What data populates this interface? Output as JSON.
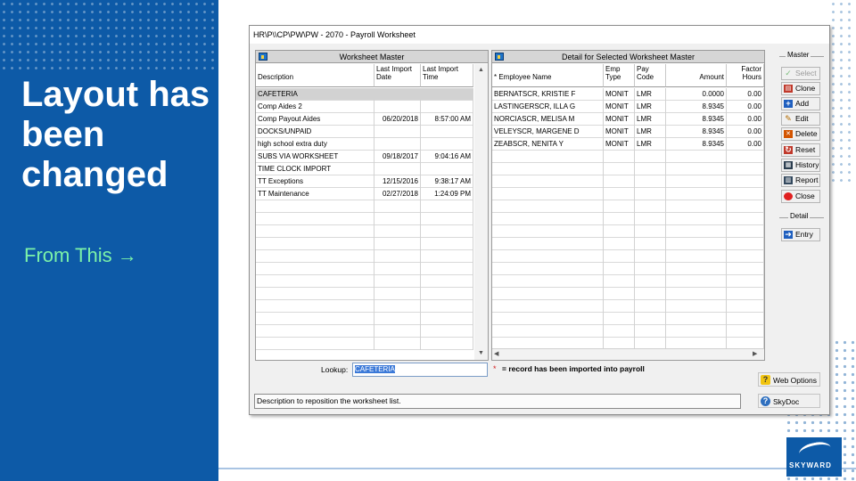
{
  "slide": {
    "title": "Layout has been changed",
    "from_label": "From This →",
    "logo_text": "SKYWARD"
  },
  "window": {
    "title": "HR\\P\\\\CP\\PW\\PW - 2070 - Payroll Worksheet"
  },
  "master": {
    "header": "Worksheet Master",
    "columns": [
      "Description",
      "Last Import\nDate",
      "Last Import\nTime"
    ],
    "rows": [
      {
        "description": "CAFETERIA",
        "date": "",
        "time": "",
        "selected": true
      },
      {
        "description": "Comp Aides 2",
        "date": "",
        "time": ""
      },
      {
        "description": "Comp Payout Aides",
        "date": "06/20/2018",
        "time": "8:57:00 AM"
      },
      {
        "description": "DOCKS/UNPAID",
        "date": "",
        "time": ""
      },
      {
        "description": "high school extra duty",
        "date": "",
        "time": ""
      },
      {
        "description": "SUBS VIA WORKSHEET",
        "date": "09/18/2017",
        "time": "9:04:16 AM"
      },
      {
        "description": "TIME CLOCK IMPORT",
        "date": "",
        "time": ""
      },
      {
        "description": "TT Exceptions",
        "date": "12/15/2016",
        "time": "9:38:17 AM"
      },
      {
        "description": "TT Maintenance",
        "date": "02/27/2018",
        "time": "1:24:09 PM"
      }
    ]
  },
  "detail": {
    "header": "Detail for Selected Worksheet Master",
    "columns": [
      "* Employee Name",
      "Emp\nType",
      "Pay\nCode",
      "Amount",
      "Factor\nHours"
    ],
    "rows": [
      {
        "name": "BERNATSCR, KRISTIE F",
        "emp_type": "MONIT",
        "pay_code": "LMR",
        "amount": "0.0000",
        "factor": "0.00"
      },
      {
        "name": "LASTINGERSCR, ILLA G",
        "emp_type": "MONIT",
        "pay_code": "LMR",
        "amount": "8.9345",
        "factor": "0.00"
      },
      {
        "name": "NORCIASCR, MELISA M",
        "emp_type": "MONIT",
        "pay_code": "LMR",
        "amount": "8.9345",
        "factor": "0.00"
      },
      {
        "name": "VELEYSCR, MARGENE D",
        "emp_type": "MONIT",
        "pay_code": "LMR",
        "amount": "8.9345",
        "factor": "0.00"
      },
      {
        "name": "ZEABSCR, NENITA Y",
        "emp_type": "MONIT",
        "pay_code": "LMR",
        "amount": "8.9345",
        "factor": "0.00"
      }
    ]
  },
  "side_panel": {
    "master_label": "Master",
    "detail_label": "Detail",
    "buttons": {
      "select": "Select",
      "clone": "Clone",
      "add": "Add",
      "edit": "Edit",
      "delete": "Delete",
      "reset": "Reset",
      "history": "History",
      "report": "Report",
      "close": "Close",
      "entry": "Entry"
    }
  },
  "lookup": {
    "label": "Lookup:",
    "value": "CAFETERIA"
  },
  "legend": {
    "star": "*",
    "text": "= record has been imported into payroll"
  },
  "status": "Description to reposition the worksheet list.",
  "bottom_buttons": {
    "web_options": "Web Options",
    "skydoc": "SkyDoc"
  },
  "colors": {
    "slide_blue": "#0d5aa7",
    "from_text_green": "#7cf3a8",
    "selected_row": "#d2d2d2",
    "lookup_highlight": "#3b79d8",
    "legend_star": "#d42020"
  }
}
